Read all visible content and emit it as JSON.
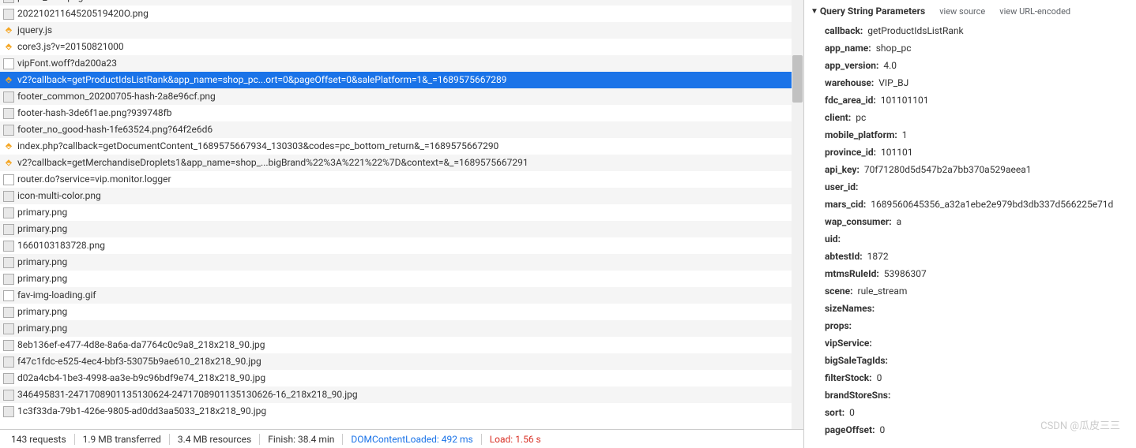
{
  "requests": [
    {
      "name": "police_icon.png",
      "icon": "img"
    },
    {
      "name": "20221021164520519420O.png",
      "icon": "img"
    },
    {
      "name": "jquery.js",
      "icon": "script"
    },
    {
      "name": "core3.js?v=20150821000",
      "icon": "script"
    },
    {
      "name": "vipFont.woff?da200a23",
      "icon": "doc"
    },
    {
      "name": "v2?callback=getProductIdsListRank&app_name=shop_pc...ort=0&pageOffset=0&salePlatform=1&_=1689575667289",
      "icon": "script",
      "selected": true
    },
    {
      "name": "footer_common_20200705-hash-2a8e96cf.png",
      "icon": "img"
    },
    {
      "name": "footer-hash-3de6f1ae.png?939748fb",
      "icon": "img"
    },
    {
      "name": "footer_no_good-hash-1fe63524.png?64f2e6d6",
      "icon": "img"
    },
    {
      "name": "index.php?callback=getDocumentContent_1689575667934_130303&codes=pc_bottom_return&_=1689575667290",
      "icon": "script"
    },
    {
      "name": "v2?callback=getMerchandiseDroplets1&app_name=shop_...bigBrand%22%3A%221%22%7D&context=&_=1689575667291",
      "icon": "script"
    },
    {
      "name": "router.do?service=vip.monitor.logger",
      "icon": "doc"
    },
    {
      "name": "icon-multi-color.png",
      "icon": "img"
    },
    {
      "name": "primary.png",
      "icon": "img"
    },
    {
      "name": "primary.png",
      "icon": "img"
    },
    {
      "name": "1660103183728.png",
      "icon": "img"
    },
    {
      "name": "primary.png",
      "icon": "img"
    },
    {
      "name": "primary.png",
      "icon": "img"
    },
    {
      "name": "fav-img-loading.gif",
      "icon": "doc"
    },
    {
      "name": "primary.png",
      "icon": "img"
    },
    {
      "name": "primary.png",
      "icon": "img"
    },
    {
      "name": "8eb136ef-e477-4d8e-8a6a-da7764c0c9a8_218x218_90.jpg",
      "icon": "img"
    },
    {
      "name": "f47c1fdc-e525-4ec4-bbf3-53075b9ae610_218x218_90.jpg",
      "icon": "img"
    },
    {
      "name": "d02a4cb4-1be3-4998-aa3e-b9c96bdf9e74_218x218_90.jpg",
      "icon": "img"
    },
    {
      "name": "346495831-2471708901135130624-2471708901135130626-16_218x218_90.jpg",
      "icon": "img"
    },
    {
      "name": "1c3f33da-79b1-426e-9805-ad0dd3aa5033_218x218_90.jpg",
      "icon": "img"
    }
  ],
  "status": {
    "requests": "143 requests",
    "transferred": "1.9 MB transferred",
    "resources": "3.4 MB resources",
    "finish": "Finish: 38.4 min",
    "dom": "DOMContentLoaded: 492 ms",
    "load": "Load: 1.56 s"
  },
  "section": {
    "title": "Query String Parameters",
    "view_source": "view source",
    "view_encoded": "view URL-encoded"
  },
  "params": [
    {
      "key": "callback",
      "val": "getProductIdsListRank"
    },
    {
      "key": "app_name",
      "val": "shop_pc"
    },
    {
      "key": "app_version",
      "val": "4.0"
    },
    {
      "key": "warehouse",
      "val": "VIP_BJ"
    },
    {
      "key": "fdc_area_id",
      "val": "101101101"
    },
    {
      "key": "client",
      "val": "pc"
    },
    {
      "key": "mobile_platform",
      "val": "1"
    },
    {
      "key": "province_id",
      "val": "101101"
    },
    {
      "key": "api_key",
      "val": "70f71280d5d547b2a7bb370a529aeea1"
    },
    {
      "key": "user_id",
      "val": ""
    },
    {
      "key": "mars_cid",
      "val": "1689560645356_a32a1ebe2e979bd3db337d566225e71d"
    },
    {
      "key": "wap_consumer",
      "val": "a"
    },
    {
      "key": "uid",
      "val": ""
    },
    {
      "key": "abtestId",
      "val": "1872"
    },
    {
      "key": "mtmsRuleId",
      "val": "53986307"
    },
    {
      "key": "scene",
      "val": "rule_stream"
    },
    {
      "key": "sizeNames",
      "val": ""
    },
    {
      "key": "props",
      "val": ""
    },
    {
      "key": "vipService",
      "val": ""
    },
    {
      "key": "bigSaleTagIds",
      "val": ""
    },
    {
      "key": "filterStock",
      "val": "0"
    },
    {
      "key": "brandStoreSns",
      "val": ""
    },
    {
      "key": "sort",
      "val": "0"
    },
    {
      "key": "pageOffset",
      "val": "0"
    }
  ],
  "watermark": "CSDN @瓜皮三三"
}
